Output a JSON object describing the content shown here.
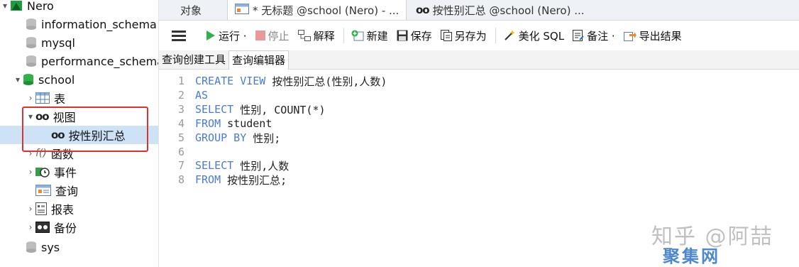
{
  "sidebar": {
    "connection": "Nero",
    "databases": [
      "information_schema",
      "mysql",
      "performance_schema"
    ],
    "school": {
      "label": "school",
      "children": {
        "tables": "表",
        "views": "视图",
        "view_item": "按性别汇总",
        "functions": "函数",
        "events": "事件",
        "queries": "查询",
        "reports": "报表",
        "backups": "备份"
      }
    },
    "sys": "sys"
  },
  "tabs": {
    "objects": "对象",
    "query_tab": "* 无标题 @school (Nero) - ...",
    "view_tab": "按性别汇总 @school (Nero) ..."
  },
  "toolbar": {
    "run": "运行 ·",
    "stop": "停止",
    "explain": "解释",
    "new": "新建",
    "save": "保存",
    "save_as": "另存为",
    "beautify": "美化 SQL",
    "note": "备注 ·",
    "export": "导出结果"
  },
  "subtabs": {
    "builder": "查询创建工具",
    "editor": "查询编辑器"
  },
  "editor": {
    "lines": [
      {
        "num": "1",
        "kw": "CREATE VIEW",
        "rest": " 按性别汇总(性别,人数)"
      },
      {
        "num": "2",
        "kw": "AS",
        "rest": ""
      },
      {
        "num": "3",
        "kw": "SELECT",
        "rest": " 性别, COUNT(*)"
      },
      {
        "num": "4",
        "kw": "FROM",
        "rest": " student"
      },
      {
        "num": "5",
        "kw": "GROUP BY",
        "rest": " 性别;"
      },
      {
        "num": "6",
        "kw": "",
        "rest": ""
      },
      {
        "num": "7",
        "kw": "SELECT",
        "rest": " 性别,人数"
      },
      {
        "num": "8",
        "kw": "FROM",
        "rest": " 按性别汇总;"
      }
    ]
  },
  "watermark": {
    "line1": "知乎 @阿喆",
    "line2": "聚集网"
  },
  "colors": {
    "keyword": "#4a7bd8",
    "selection": "#cde3f5",
    "highlight": "#e0302f"
  }
}
